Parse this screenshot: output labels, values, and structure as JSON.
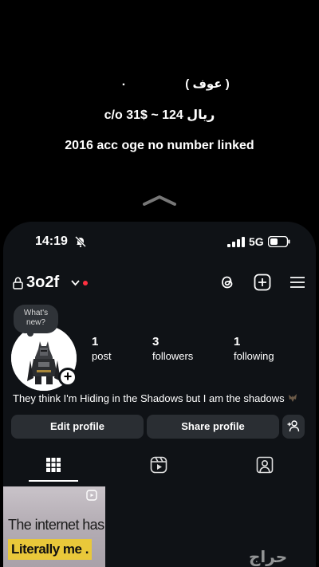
{
  "caption": {
    "dot": ".",
    "line1": "( عوف )",
    "line2": "c/o 31$ ~ 124 ريال",
    "line3": "2016 acc oge no number linked"
  },
  "status_bar": {
    "time": "14:19",
    "network": "5G",
    "icons": [
      "bell-muted-icon",
      "signal-icon",
      "battery-icon"
    ]
  },
  "header": {
    "username": "3o2f",
    "icons": [
      "lock-icon",
      "chevron-down-icon",
      "threads-icon",
      "plus-square-icon",
      "menu-icon"
    ],
    "notification_dot_color": "#ff3040"
  },
  "profile": {
    "note_bubble": [
      "What's",
      "new?"
    ],
    "stats": [
      {
        "value": "1",
        "label": "post"
      },
      {
        "value": "3",
        "label": "followers"
      },
      {
        "value": "1",
        "label": "following"
      }
    ],
    "bio": "They think I'm Hiding in the Shadows but I am the shadows"
  },
  "buttons": {
    "edit": "Edit profile",
    "share": "Share profile"
  },
  "tabs": [
    "grid-icon",
    "reels-icon",
    "tagged-icon"
  ],
  "posts": [
    {
      "line1": "The internet has",
      "line2": "Literally me ."
    }
  ],
  "watermark": "حراج",
  "colors": {
    "background": "#000000",
    "panel": "#0f1216",
    "button": "#2a2e33",
    "highlight": "#e9c83a"
  }
}
